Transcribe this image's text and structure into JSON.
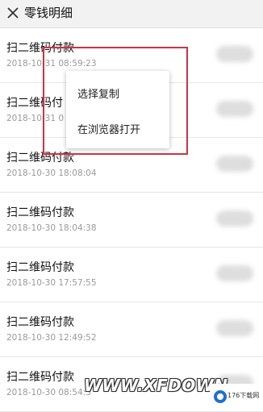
{
  "header": {
    "title": "零钱明细",
    "close_icon": "close-icon"
  },
  "transactions": [
    {
      "title": "扫二维码付款",
      "time": "2018-10-31 08:59:23"
    },
    {
      "title": "扫二维码付",
      "time": "2018-10-31 0"
    },
    {
      "title": "扫二维码付款",
      "time": "2018-10-30 18:08:04"
    },
    {
      "title": "扫二维码付款",
      "time": "2018-10-30 18:04:38"
    },
    {
      "title": "扫二维码付款",
      "time": "2018-10-30 17:57:55"
    },
    {
      "title": "扫二维码付款",
      "time": "2018-10-30 12:49:52"
    },
    {
      "title": "扫二维码付款",
      "time": "2018-10-30 08:54:3"
    }
  ],
  "context_menu": {
    "items": [
      "选择复制",
      "在浏览器打开"
    ]
  },
  "watermark": {
    "text": "WWW.XFDOWN",
    "logo_text": "176下载网"
  },
  "colors": {
    "highlight_border": "#cc3344",
    "topbar_bg": "#f2f2f2"
  }
}
